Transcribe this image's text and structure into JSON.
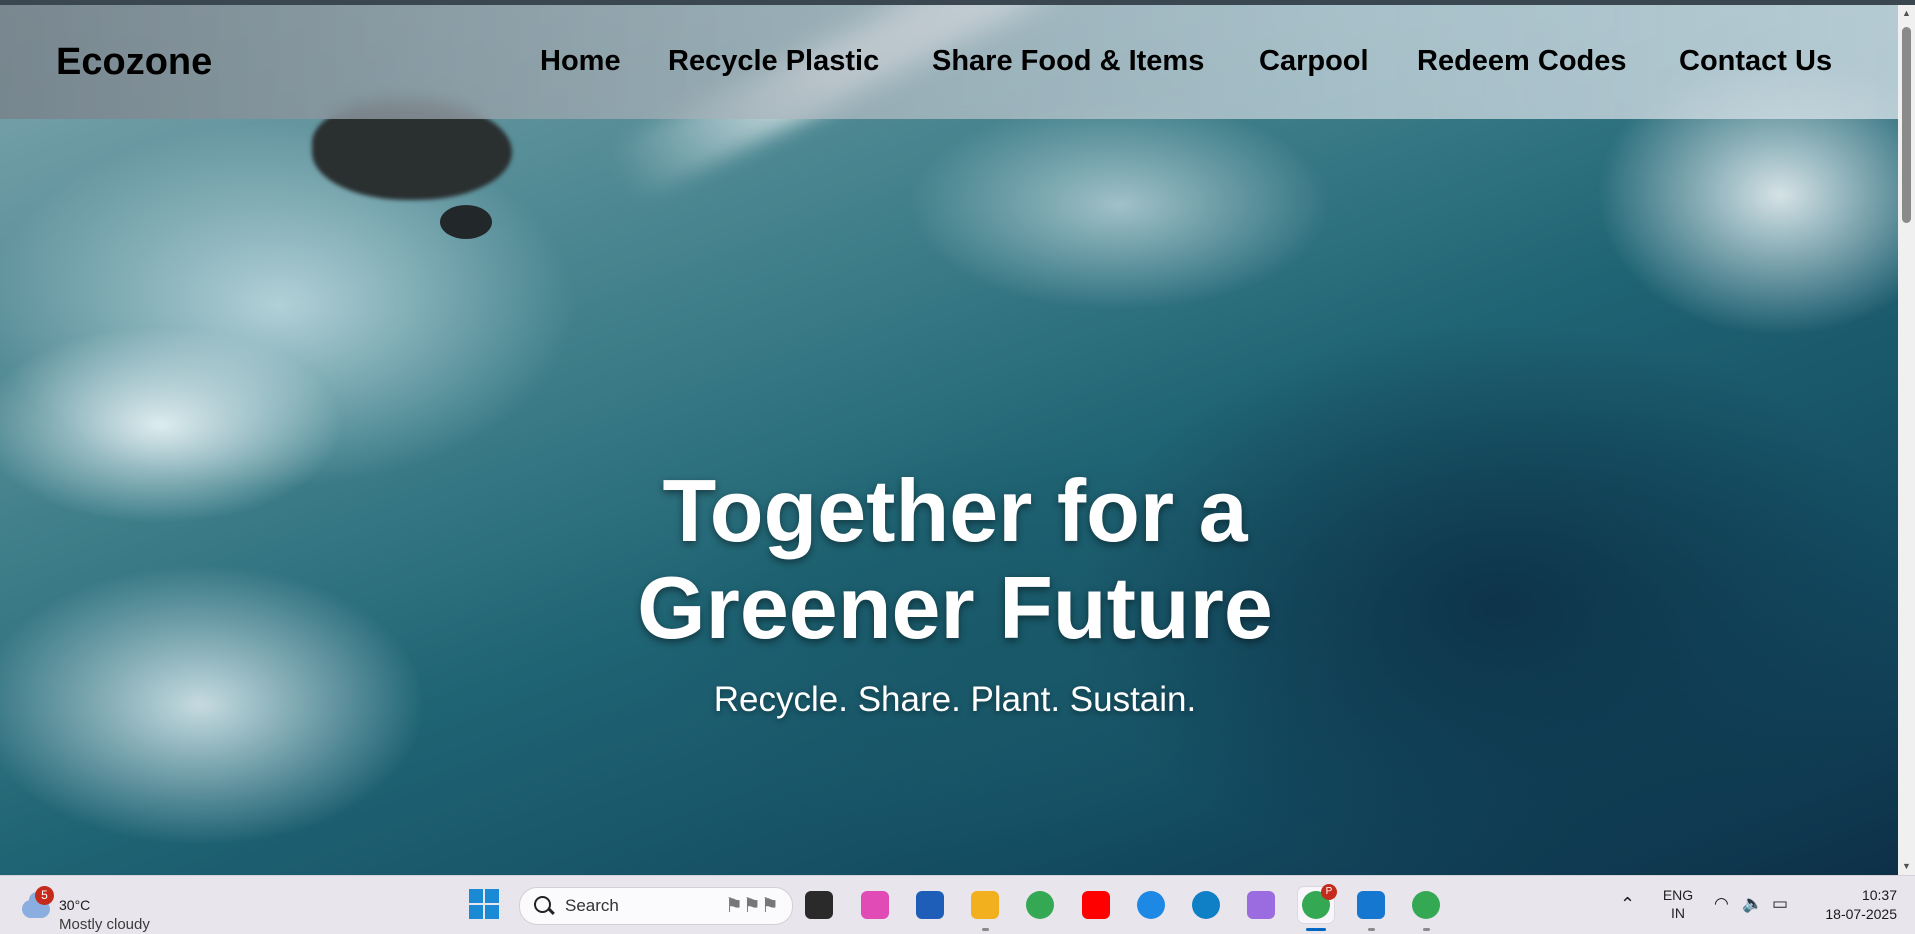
{
  "site": {
    "logo": "Ecozone",
    "nav": [
      "Home",
      "Recycle Plastic",
      "Share Food & Items",
      "Carpool",
      "Redeem Codes",
      "Contact Us"
    ]
  },
  "hero": {
    "headline_line1": "Together for a",
    "headline_line2": "Greener Future",
    "tagline": "Recycle. Share. Plant. Sustain."
  },
  "taskbar": {
    "weather": {
      "temperature": "30°C",
      "condition": "Mostly cloudy",
      "badge": "5",
      "icon": "cloud-icon"
    },
    "search_placeholder": "Search",
    "apps": [
      {
        "name": "task-view-icon",
        "color": "#2a2a2a"
      },
      {
        "name": "copilot-icon",
        "color": "#e14bb6"
      },
      {
        "name": "microsoft-store-icon",
        "color": "#1e5eb8"
      },
      {
        "name": "file-explorer-icon",
        "color": "#f2b01e"
      },
      {
        "name": "chrome-icon",
        "color": "#34a853"
      },
      {
        "name": "youtube-icon",
        "color": "#ff0000"
      },
      {
        "name": "help-icon",
        "color": "#1e88e5"
      },
      {
        "name": "edge-icon",
        "color": "#0f7fc6"
      },
      {
        "name": "gemini-icon",
        "color": "#9b6ce0"
      },
      {
        "name": "chrome-profile-icon",
        "color": "#34a853",
        "badge": "P"
      },
      {
        "name": "vscode-icon",
        "color": "#1677d0"
      },
      {
        "name": "chrome-profile-2-icon",
        "color": "#34a853"
      }
    ],
    "language": "ENG",
    "region": "IN",
    "time": "10:37",
    "date": "18-07-2025"
  }
}
